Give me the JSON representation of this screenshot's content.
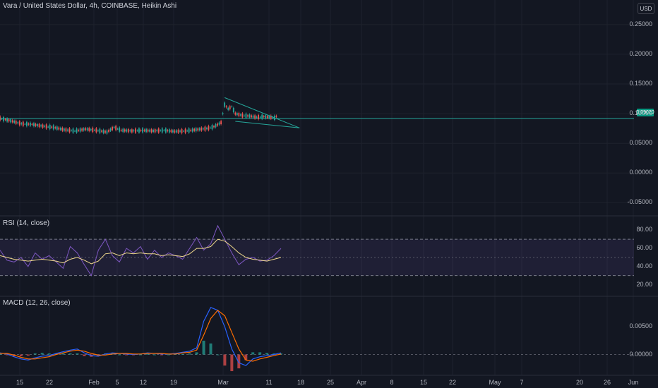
{
  "header": {
    "symbol_title": "Vara / United States Dollar, 4h, COINBASE, Heikin Ashi",
    "currency": "USD"
  },
  "colors": {
    "background": "#131722",
    "grid": "#1e222d",
    "up": "#26a69a",
    "down": "#ef5350",
    "rsi_line": "#7e57c2",
    "rsi_ma": "#f0d98c",
    "rsi_band": "#7e57c2",
    "macd_line": "#2962ff",
    "signal_line": "#ff6d00",
    "hline": "#26a69a",
    "pattern": "#26a69a"
  },
  "price_tag": "0.09020",
  "chart_data": [
    {
      "type": "candlestick",
      "title": "Vara / United States Dollar, 4h, COINBASE, Heikin Ashi",
      "x_ticks": [
        "15",
        "22",
        "Feb",
        "5",
        "12",
        "19",
        "Mar",
        "11",
        "18",
        "25",
        "Apr",
        "8",
        "15",
        "22",
        "May",
        "7",
        "20",
        "26",
        "Jun"
      ],
      "y_ticks": [
        "0.25000",
        "0.20000",
        "0.15000",
        "0.10000",
        "0.05000",
        "0.00000",
        "-0.05000"
      ],
      "ylim": [
        -0.065,
        0.27
      ],
      "grid": true,
      "x_range_days": [
        0,
        140
      ],
      "series": {
        "name": "",
        "points": [
          {
            "day": 0,
            "value": 0.092
          },
          {
            "day": 3,
            "value": 0.088
          },
          {
            "day": 6,
            "value": 0.083
          },
          {
            "day": 9,
            "value": 0.082
          },
          {
            "day": 12,
            "value": 0.079
          },
          {
            "day": 15,
            "value": 0.077
          },
          {
            "day": 18,
            "value": 0.073
          },
          {
            "day": 21,
            "value": 0.071
          },
          {
            "day": 24,
            "value": 0.074
          },
          {
            "day": 27,
            "value": 0.072
          },
          {
            "day": 30,
            "value": 0.069
          },
          {
            "day": 32,
            "value": 0.077
          },
          {
            "day": 34,
            "value": 0.072
          },
          {
            "day": 37,
            "value": 0.071
          },
          {
            "day": 40,
            "value": 0.072
          },
          {
            "day": 43,
            "value": 0.071
          },
          {
            "day": 46,
            "value": 0.072
          },
          {
            "day": 49,
            "value": 0.07
          },
          {
            "day": 52,
            "value": 0.071
          },
          {
            "day": 55,
            "value": 0.073
          },
          {
            "day": 58,
            "value": 0.075
          },
          {
            "day": 60,
            "value": 0.078
          },
          {
            "day": 62,
            "value": 0.085
          },
          {
            "day": 63,
            "value": 0.115
          },
          {
            "day": 64,
            "value": 0.108
          },
          {
            "day": 65,
            "value": 0.112
          },
          {
            "day": 66,
            "value": 0.1
          },
          {
            "day": 68,
            "value": 0.097
          },
          {
            "day": 70,
            "value": 0.096
          },
          {
            "day": 72,
            "value": 0.094
          },
          {
            "day": 74,
            "value": 0.095
          },
          {
            "day": 76,
            "value": 0.094
          },
          {
            "day": 77,
            "value": 0.093
          },
          {
            "day": 78,
            "value": 0.098
          }
        ]
      },
      "horizontal_line": 0.092,
      "pattern_lines": [
        {
          "from": {
            "day": 63,
            "value": 0.127
          },
          "to": {
            "day": 84,
            "value": 0.076
          }
        },
        {
          "from": {
            "day": 66,
            "value": 0.087
          },
          "to": {
            "day": 84,
            "value": 0.076
          }
        }
      ]
    },
    {
      "type": "line",
      "title": "RSI (14, close)",
      "y_ticks": [
        "80.00",
        "60.00",
        "40.00",
        "20.00"
      ],
      "ylim": [
        15,
        88
      ],
      "band": [
        30,
        70
      ],
      "midline": 50,
      "series": [
        {
          "name": "RSI",
          "values": [
            58,
            47,
            45,
            50,
            40,
            55,
            48,
            52,
            45,
            38,
            62,
            55,
            42,
            30,
            58,
            70,
            52,
            45,
            60,
            55,
            62,
            48,
            58,
            50,
            55,
            52,
            48,
            60,
            72,
            58,
            65,
            85,
            70,
            55,
            42,
            48,
            50,
            46,
            47,
            52,
            60
          ]
        },
        {
          "name": "MA",
          "values": [
            52,
            50,
            48,
            47,
            46,
            47,
            48,
            47,
            46,
            44,
            48,
            50,
            47,
            43,
            46,
            54,
            55,
            52,
            55,
            54,
            55,
            54,
            54,
            52,
            53,
            52,
            51,
            54,
            60,
            60,
            62,
            70,
            68,
            62,
            55,
            50,
            48,
            47,
            46,
            48,
            50
          ]
        }
      ]
    },
    {
      "type": "line",
      "title": "MACD (12, 26, close)",
      "y_ticks": [
        "0.00500",
        "0.00000"
      ],
      "ylim": [
        -0.0035,
        0.0095
      ],
      "series": [
        {
          "name": "MACD",
          "values": [
            0.0003,
            0.0001,
            -0.0004,
            -0.0008,
            -0.001,
            -0.0006,
            -0.0003,
            -0.0002,
            0.0002,
            0.0005,
            0.0008,
            0.001,
            0.0003,
            -0.0002,
            -0.0003,
            0.0001,
            0.0003,
            0.0002,
            0.0001,
            0.0,
            0.0001,
            0.0003,
            0.0002,
            0.0001,
            0.0001,
            0.0002,
            0.0004,
            0.0006,
            0.0012,
            0.006,
            0.0085,
            0.008,
            0.005,
            0.001,
            -0.0015,
            -0.002,
            -0.0008,
            -0.0004,
            -0.0002,
            0.0,
            0.0003
          ]
        },
        {
          "name": "Signal",
          "values": [
            0.0002,
            0.0002,
            -0.0001,
            -0.0005,
            -0.0008,
            -0.0008,
            -0.0006,
            -0.0004,
            0.0,
            0.0003,
            0.0006,
            0.0008,
            0.0006,
            0.0002,
            -0.0001,
            -0.0001,
            0.0001,
            0.0002,
            0.0002,
            0.0001,
            0.0001,
            0.0002,
            0.0002,
            0.0002,
            0.0001,
            0.0001,
            0.0003,
            0.0004,
            0.0008,
            0.0035,
            0.0065,
            0.008,
            0.007,
            0.004,
            0.001,
            -0.001,
            -0.0012,
            -0.0008,
            -0.0005,
            -0.0002,
            0.0001
          ]
        }
      ]
    }
  ]
}
